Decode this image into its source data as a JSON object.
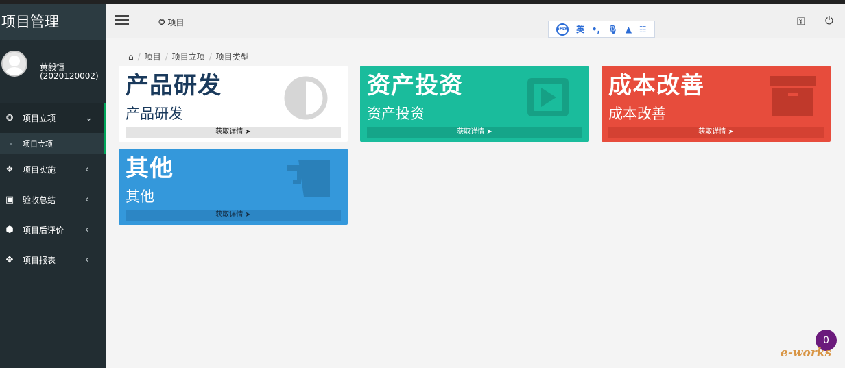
{
  "sidebar": {
    "brand": "项目管理",
    "user": {
      "name": "黄毅恒",
      "id": "(2020120002)"
    },
    "items": [
      {
        "label": "项目立项",
        "icon": "cube-outline-icon",
        "expanded": true
      },
      {
        "label": "项目实施",
        "icon": "cubes-icon"
      },
      {
        "label": "验收总结",
        "icon": "archive-icon"
      },
      {
        "label": "项目后评价",
        "icon": "cube-icon"
      },
      {
        "label": "项目报表",
        "icon": "move-arrows-icon"
      }
    ],
    "submenu": {
      "label": "项目立项"
    }
  },
  "header": {
    "tab_label": "项目",
    "ime": {
      "logo": "iFLY",
      "lang": "英"
    }
  },
  "breadcrumb": [
    "项目",
    "项目立项",
    "项目类型"
  ],
  "cards": [
    {
      "title": "产品研发",
      "subtitle": "产品研发",
      "footer": "获取详情",
      "icon": "adjust-icon",
      "color": "#ffffff"
    },
    {
      "title": "资产投资",
      "subtitle": "资产投资",
      "footer": "获取详情",
      "icon": "play-square-icon",
      "color": "#1abc9c"
    },
    {
      "title": "成本改善",
      "subtitle": "成本改善",
      "footer": "获取详情",
      "icon": "archive-box-icon",
      "color": "#e74c3c"
    },
    {
      "title": "其他",
      "subtitle": "其他",
      "footer": "获取详情",
      "icon": "mug-icon",
      "color": "#3498db"
    }
  ],
  "badge": "0",
  "watermark": "e-works"
}
